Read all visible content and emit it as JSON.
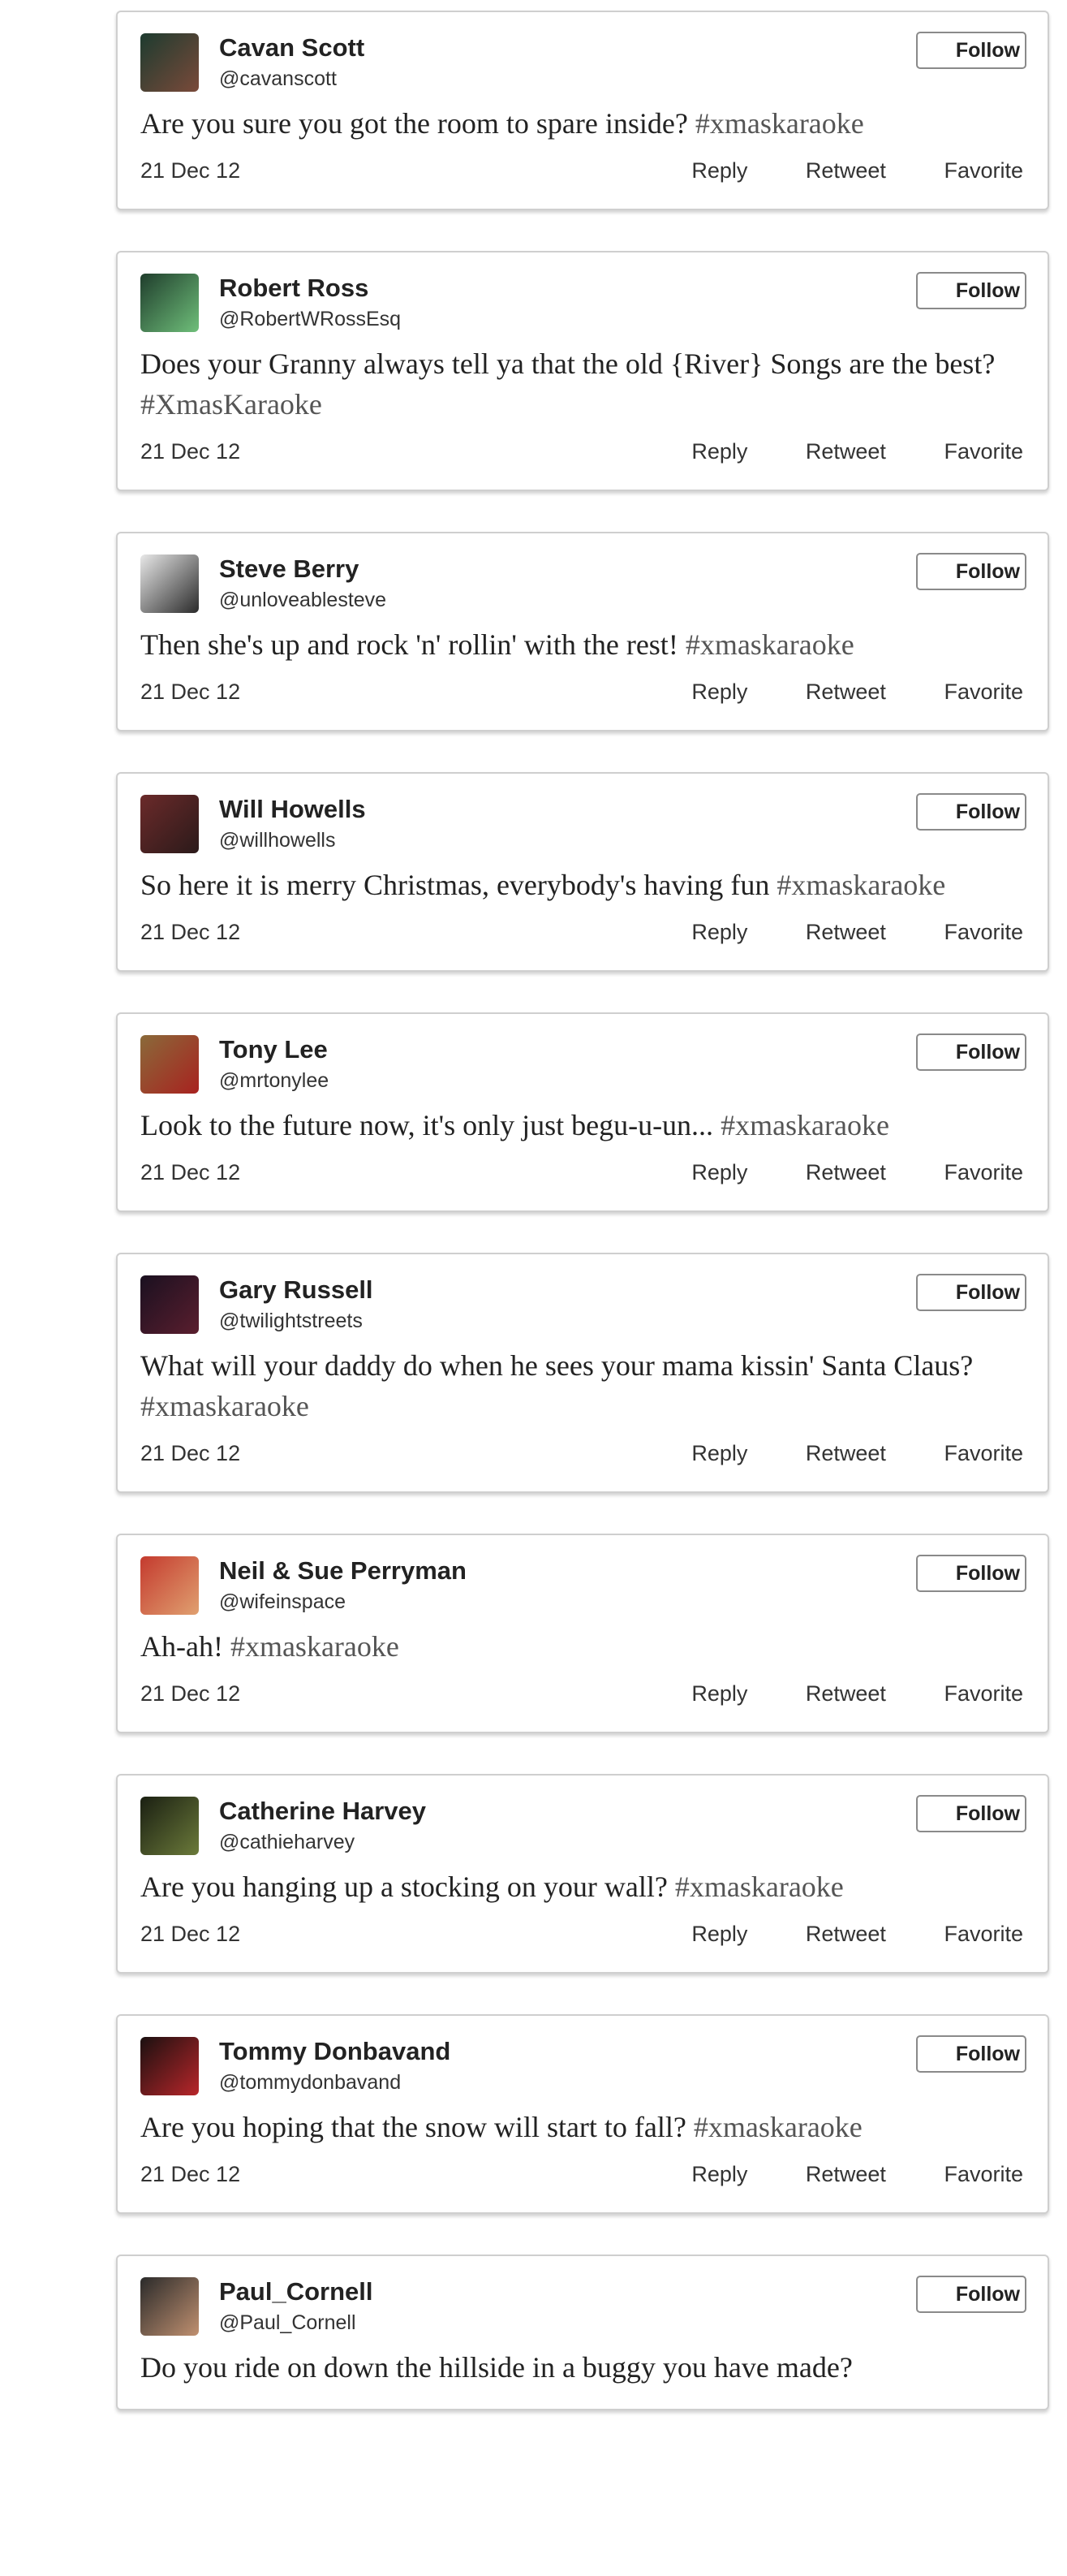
{
  "colors": {
    "border": "#cfcfcf",
    "text": "#222222",
    "hashtag": "#555555"
  },
  "actions": {
    "follow": "Follow",
    "reply": "Reply",
    "retweet": "Retweet",
    "favorite": "Favorite"
  },
  "tweets": [
    {
      "name": "Cavan Scott",
      "handle": "@cavanscott",
      "text": "Are you sure you got the room to spare inside?",
      "hashtag": "#xmaskaraoke",
      "date": "21 Dec 12",
      "avatar_colors": [
        "#1d3b2f",
        "#7a4a3a"
      ]
    },
    {
      "name": "Robert Ross",
      "handle": "@RobertWRossEsq",
      "text": "Does your Granny always tell ya that the old {River} Songs are the best?",
      "hashtag": "#XmasKaraoke",
      "date": "21 Dec 12",
      "avatar_colors": [
        "#1f3d2c",
        "#6fbf7a"
      ]
    },
    {
      "name": "Steve Berry",
      "handle": "@unloveablesteve",
      "text": "Then she's up and rock 'n' rollin' with the rest!",
      "hashtag": "#xmaskaraoke",
      "date": "21 Dec 12",
      "avatar_colors": [
        "#e8e8e8",
        "#2a2a2a"
      ]
    },
    {
      "name": "Will Howells",
      "handle": "@willhowells",
      "text": "So here it is merry Christmas, everybody's having fun",
      "hashtag": "#xmaskaraoke",
      "date": "21 Dec 12",
      "avatar_colors": [
        "#6b2a2a",
        "#2b1a1a"
      ]
    },
    {
      "name": "Tony Lee",
      "handle": "@mrtonylee",
      "text": "Look to the future now, it's only just begu-u-un...",
      "hashtag": "#xmaskaraoke",
      "date": "21 Dec 12",
      "avatar_colors": [
        "#8a6a3a",
        "#a8221f"
      ]
    },
    {
      "name": "Gary Russell",
      "handle": "@twilightstreets",
      "text": "What will your daddy do when he sees your mama kissin' Santa Claus?",
      "hashtag": "#xmaskaraoke",
      "date": "21 Dec 12",
      "avatar_colors": [
        "#1a1020",
        "#5a1e2e"
      ]
    },
    {
      "name": "Neil & Sue Perryman",
      "handle": "@wifeinspace",
      "text": "Ah-ah!",
      "hashtag": "#xmaskaraoke",
      "date": "21 Dec 12",
      "avatar_colors": [
        "#c43a2e",
        "#e0a070"
      ]
    },
    {
      "name": "Catherine Harvey",
      "handle": "@cathieharvey",
      "text": "Are you hanging up a stocking on your wall?",
      "hashtag": "#xmaskaraoke",
      "date": "21 Dec 12",
      "avatar_colors": [
        "#1a1f12",
        "#6b7a3a"
      ]
    },
    {
      "name": "Tommy Donbavand",
      "handle": "@tommydonbavand",
      "text": "Are you hoping that the snow will start to fall?",
      "hashtag": "#xmaskaraoke",
      "date": "21 Dec 12",
      "avatar_colors": [
        "#1a1010",
        "#b8262a"
      ]
    },
    {
      "name": "Paul_Cornell",
      "handle": "@Paul_Cornell",
      "text": "Do you ride on down the hillside in a buggy you have made?",
      "hashtag": "",
      "date": "",
      "avatar_colors": [
        "#2a2a2a",
        "#c09070"
      ]
    }
  ]
}
